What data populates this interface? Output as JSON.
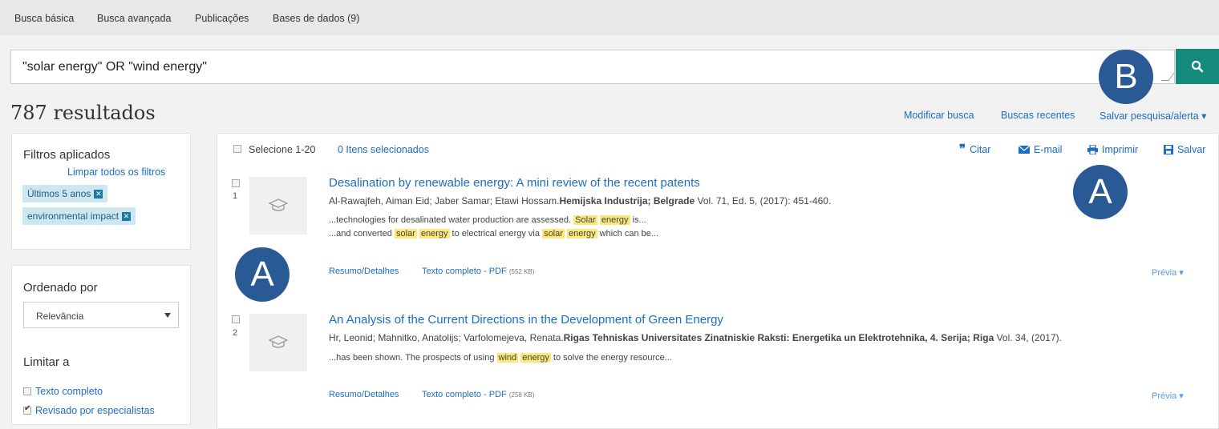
{
  "nav": {
    "items": [
      "Busca básica",
      "Busca avançada",
      "Publicações",
      "Bases de dados (9)"
    ]
  },
  "search": {
    "query": "\"solar energy\" OR \"wind energy\""
  },
  "results": {
    "count_label": "787 resultados",
    "links": [
      "Modificar busca",
      "Buscas recentes",
      "Salvar pesquisa/alerta ▾"
    ]
  },
  "filters": {
    "heading": "Filtros aplicados",
    "clear_all": "Limpar todos os filtros",
    "chips": [
      "Últimos 5 anos",
      "environmental impact"
    ]
  },
  "sort": {
    "heading": "Ordenado por",
    "selected": "Relevância",
    "limit_heading": "Limitar a",
    "options": [
      "Texto completo",
      "Revisado por especialistas"
    ]
  },
  "toolbar": {
    "select_label": "Selecione 1-20",
    "selected_count": "0 Itens selecionados",
    "cite": "Citar",
    "email": "E-mail",
    "print": "Imprimir",
    "save": "Salvar"
  },
  "records": [
    {
      "num": "1",
      "title": "Desalination by renewable energy: A mini review of the recent patents",
      "authors": "Al-Rawajfeh, Aiman Eid; Jaber Samar; Etawi Hossam.",
      "journal": "Hemijska Industrija; Belgrade",
      "details": " Vol. 71, Ed. 5,  (2017): 451-460.",
      "snippet1": [
        "...technologies for desalinated water production are assessed. ",
        "Solar",
        " ",
        "energy",
        " is..."
      ],
      "snippet2": [
        "...and converted ",
        "solar",
        " ",
        "energy",
        " to electrical energy via ",
        "solar",
        " ",
        "energy",
        " which can be..."
      ],
      "abstract": "Resumo/Detalhes",
      "fulltext": "Texto completo - PDF",
      "size": "(552 KB)",
      "preview": "Prévia ▾"
    },
    {
      "num": "2",
      "title": "An Analysis of the Current Directions in the Development of Green Energy",
      "authors": "Hr, Leonid; Mahnitko, Anatolijs; Varfolomejeva, Renata.",
      "journal": "Rigas Tehniskas Universitates Zinatniskie Raksti: Energetika un Elektrotehnika, 4. Serija; Riga",
      "details": " Vol. 34,  (2017).",
      "snippet1": [
        "...has been shown. The prospects of using ",
        "wind",
        " ",
        "energy",
        " to solve the energy resource..."
      ],
      "abstract": "Resumo/Detalhes",
      "fulltext": "Texto completo - PDF",
      "size": "(258 KB)",
      "preview": "Prévia ▾"
    }
  ],
  "annotations": [
    "A",
    "B",
    "A"
  ],
  "colors": {
    "accent": "#138a7a",
    "link": "#1b6ec2",
    "highlight": "#fbe87a",
    "badge": "#2a5a96"
  }
}
